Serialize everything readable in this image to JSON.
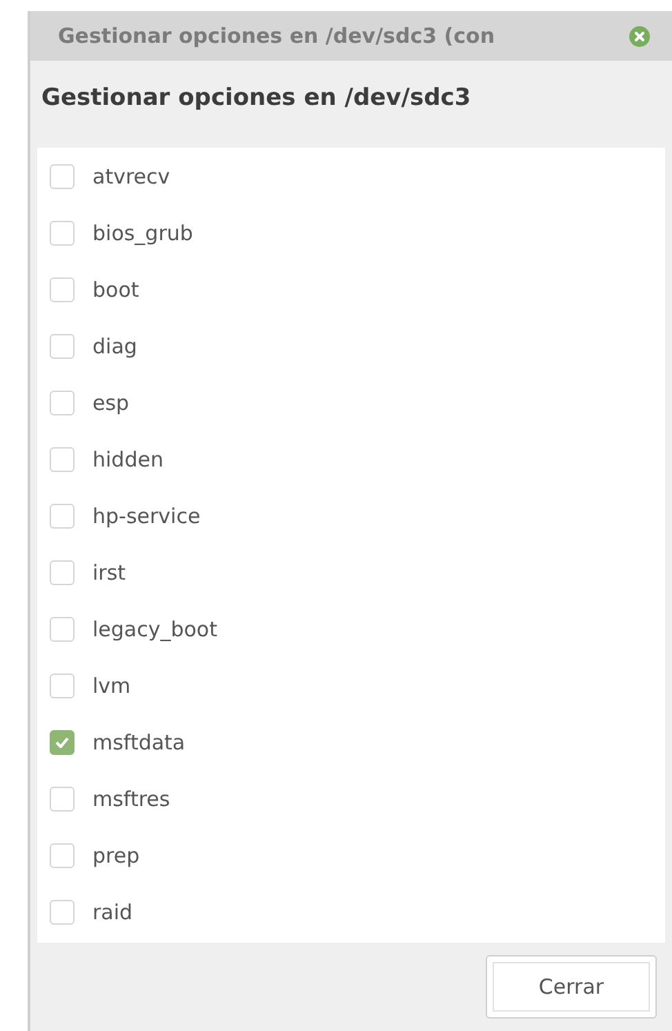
{
  "window": {
    "title": "Gestionar opciones en /dev/sdc3 (con"
  },
  "heading": "Gestionar opciones en /dev/sdc3",
  "flags": [
    {
      "label": "atvrecv",
      "checked": false
    },
    {
      "label": "bios_grub",
      "checked": false
    },
    {
      "label": "boot",
      "checked": false
    },
    {
      "label": "diag",
      "checked": false
    },
    {
      "label": "esp",
      "checked": false
    },
    {
      "label": "hidden",
      "checked": false
    },
    {
      "label": "hp-service",
      "checked": false
    },
    {
      "label": "irst",
      "checked": false
    },
    {
      "label": "legacy_boot",
      "checked": false
    },
    {
      "label": "lvm",
      "checked": false
    },
    {
      "label": "msftdata",
      "checked": true
    },
    {
      "label": "msftres",
      "checked": false
    },
    {
      "label": "prep",
      "checked": false
    },
    {
      "label": "raid",
      "checked": false
    }
  ],
  "buttons": [
    "Cerrar"
  ]
}
